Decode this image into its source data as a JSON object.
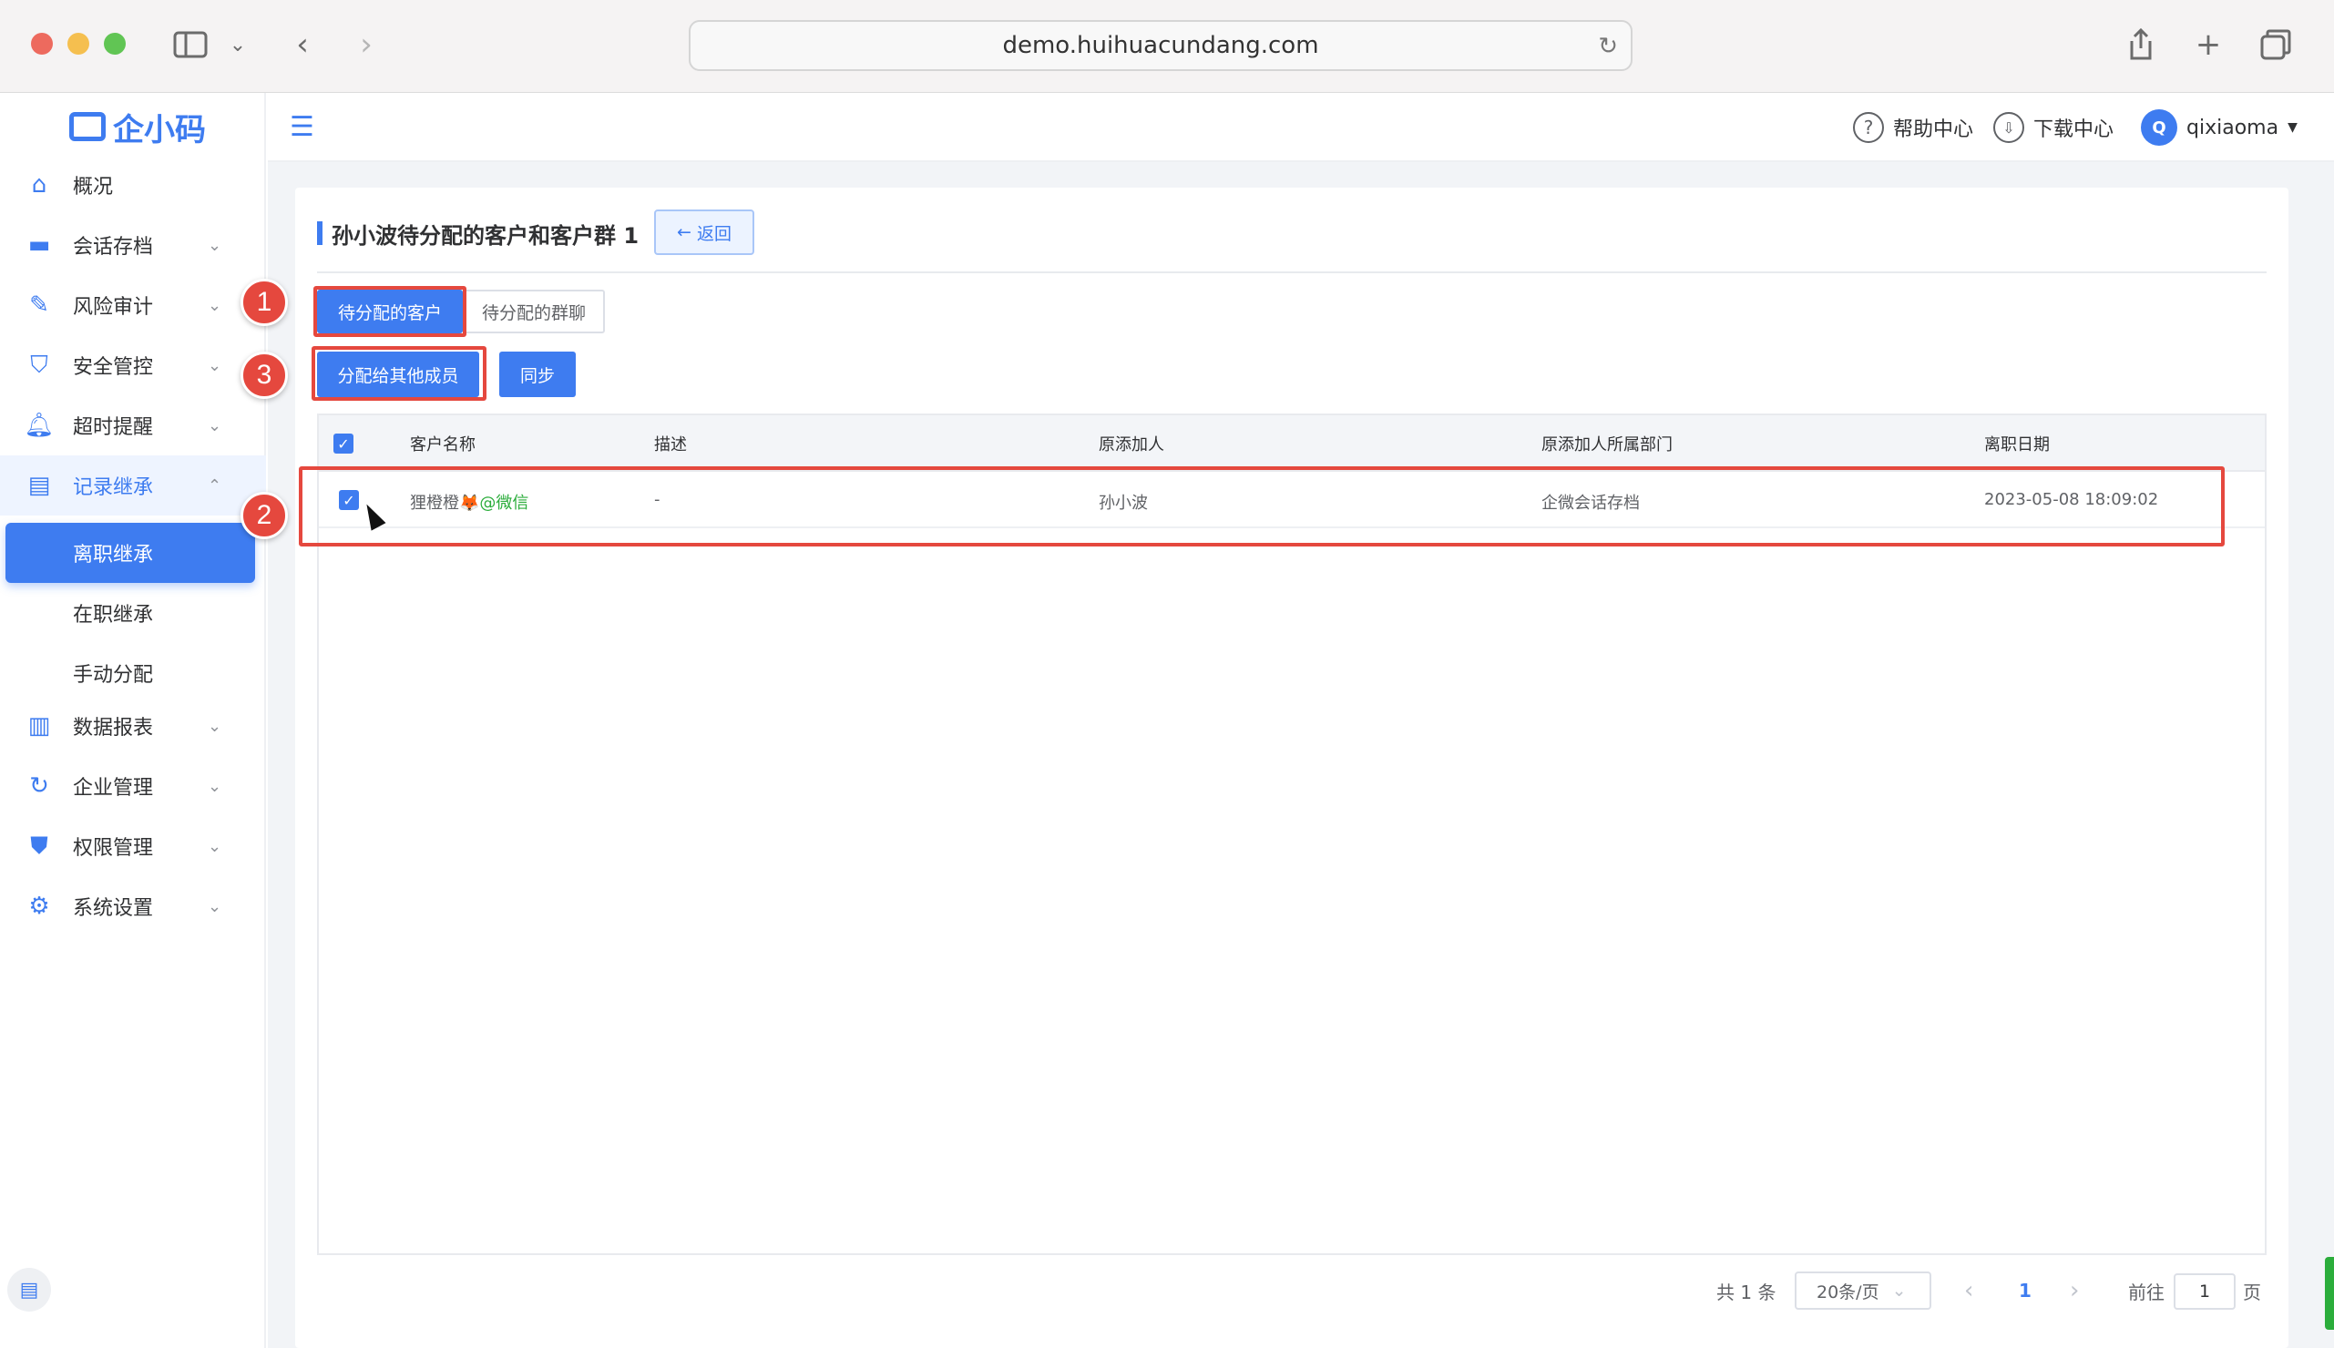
{
  "browser": {
    "url": "demo.huihuacundang.com"
  },
  "brand": {
    "name": "企小码",
    "accent": "#3e7cf0",
    "annotation_red": "#e5483e",
    "wechat_green": "#2bad3b"
  },
  "sidebar": {
    "items": [
      {
        "label": "概况",
        "icon": "home-icon"
      },
      {
        "label": "会话存档",
        "icon": "folder-icon"
      },
      {
        "label": "风险审计",
        "icon": "edit-icon"
      },
      {
        "label": "安全管控",
        "icon": "shield-icon"
      },
      {
        "label": "超时提醒",
        "icon": "bell-icon"
      },
      {
        "label": "记录继承",
        "icon": "record-icon"
      },
      {
        "label": "数据报表",
        "icon": "chart-icon"
      },
      {
        "label": "企业管理",
        "icon": "refresh-icon"
      },
      {
        "label": "权限管理",
        "icon": "badge-shield-icon"
      },
      {
        "label": "系统设置",
        "icon": "gear-icon"
      }
    ],
    "subitems": [
      {
        "label": "离职继承"
      },
      {
        "label": "在职继承"
      },
      {
        "label": "手动分配"
      }
    ]
  },
  "header": {
    "help": "帮助中心",
    "download": "下载中心",
    "avatar_initial": "Q",
    "username": "qixiaoma"
  },
  "page": {
    "title": "孙小波待分配的客户和客户群 1",
    "back_label": "返回",
    "tabs": [
      "待分配的客户",
      "待分配的群聊"
    ],
    "actions": {
      "assign": "分配给其他成员",
      "sync": "同步"
    }
  },
  "annotations": [
    "1",
    "2",
    "3"
  ],
  "table": {
    "columns": [
      "客户名称",
      "描述",
      "原添加人",
      "原添加人所属部门",
      "离职日期"
    ],
    "rows": [
      {
        "name": "狸橙橙",
        "emoji": "🦊",
        "source": "@微信",
        "desc": "-",
        "adder": "孙小波",
        "dept": "企微会话存档",
        "date": "2023-05-08 18:09:02"
      }
    ]
  },
  "pagination": {
    "total": "共 1 条",
    "page_size": "20条/页",
    "current": "1",
    "goto_prefix": "前往",
    "goto_value": "1",
    "goto_suffix": "页"
  }
}
